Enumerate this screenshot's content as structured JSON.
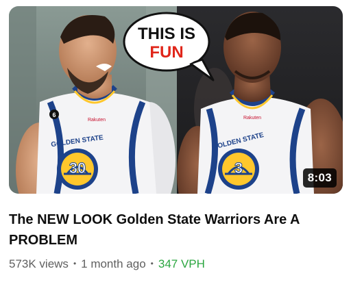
{
  "video": {
    "thumbnail": {
      "speech_bubble_line1": "THIS IS",
      "speech_bubble_line2": "FUN",
      "left_jersey_number": "30",
      "right_jersey_number": "3",
      "jersey_text": "GOLDEN STATE",
      "sponsor": "Rakuten",
      "patch_number": "6"
    },
    "duration": "8:03",
    "title": "The NEW LOOK Golden State Warriors Are A PROBLEM",
    "views": "573K views",
    "age": "1 month ago",
    "vph": "347 VPH"
  },
  "colors": {
    "vph_green": "#2ba640",
    "meta_gray": "#606060",
    "warriors_blue": "#1d428a",
    "warriors_gold": "#ffc72c",
    "bubble_red": "#e0261a"
  }
}
